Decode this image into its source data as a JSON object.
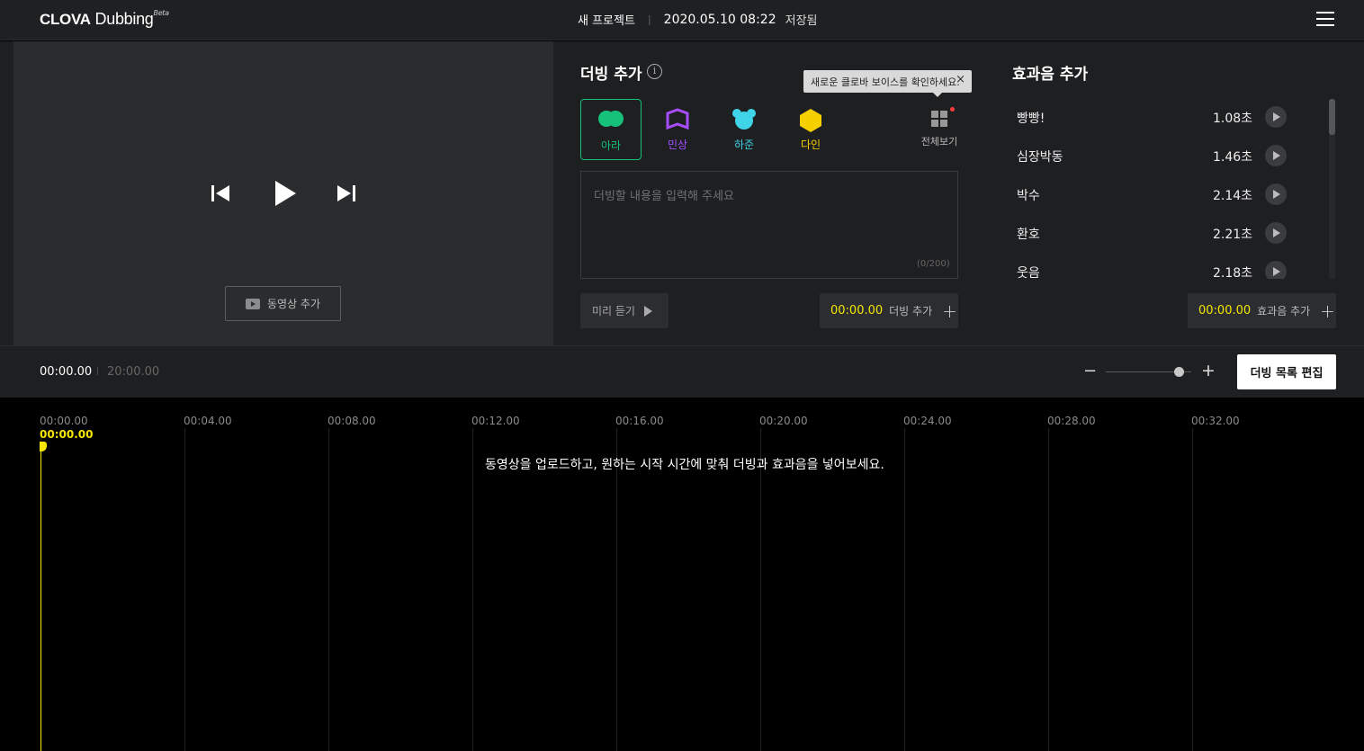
{
  "header": {
    "logo_main": "CLOVA",
    "logo_sub": "Dubbing",
    "logo_badge": "Beta",
    "project_name": "새 프로젝트",
    "separator": "|",
    "saved_time": "2020.05.10 08:22",
    "saved_label": "저장됨",
    "menu_icon": "hamburger-menu-icon"
  },
  "video": {
    "add_video_label": "동영상 추가",
    "controls": [
      "skip-back-icon",
      "play-icon",
      "skip-forward-icon"
    ]
  },
  "dubbing": {
    "title": "더빙 추가",
    "info_glyph": "i",
    "tooltip": "새로운 클로바 보이스를 확인하세요.",
    "tooltip_close": "×",
    "voices": [
      {
        "label": "아라",
        "color": "#16c27a",
        "selected": true
      },
      {
        "label": "민상",
        "color": "#a64dff",
        "selected": false
      },
      {
        "label": "하준",
        "color": "#3fd4e8",
        "selected": false
      },
      {
        "label": "다인",
        "color": "#f7d000",
        "selected": false
      }
    ],
    "all_voices_label": "전체보기",
    "input_placeholder": "더빙할 내용을 입력해 주세요",
    "input_value": "",
    "char_count": "(0/200)",
    "preview_label": "미리 듣기",
    "add_time": "00:00.00",
    "add_label": "더빙 추가",
    "plus": "+"
  },
  "sfx": {
    "title": "효과음 추가",
    "items": [
      {
        "name": "빵빵!",
        "duration": "1.08초"
      },
      {
        "name": "심장박동",
        "duration": "1.46초"
      },
      {
        "name": "박수",
        "duration": "2.14초"
      },
      {
        "name": "환호",
        "duration": "2.21초"
      },
      {
        "name": "웃음",
        "duration": "2.18초"
      }
    ],
    "add_time": "00:00.00",
    "add_label": "효과음 추가",
    "plus": "+"
  },
  "timebar": {
    "current_time": "00:00.00",
    "separator": "|",
    "total_time": "20:00.00",
    "zoom_minus": "−",
    "zoom_plus": "+",
    "zoom_level": 0.85,
    "edit_list_label": "더빙 목록 편집"
  },
  "timeline": {
    "ticks": [
      "00:00.00",
      "00:04.00",
      "00:08.00",
      "00:12.00",
      "00:16.00",
      "00:20.00",
      "00:24.00",
      "00:28.00",
      "00:32.00"
    ],
    "playhead_time": "00:00.00",
    "hint": "동영상을 업로드하고, 원하는 시작 시간에 맞춰 더빙과 효과음을 넣어보세요."
  },
  "colors": {
    "accent_yellow": "#f7e600",
    "accent_green": "#16c27a",
    "panel_bg": "#1e1f21",
    "video_bg": "#2a2c2e"
  }
}
